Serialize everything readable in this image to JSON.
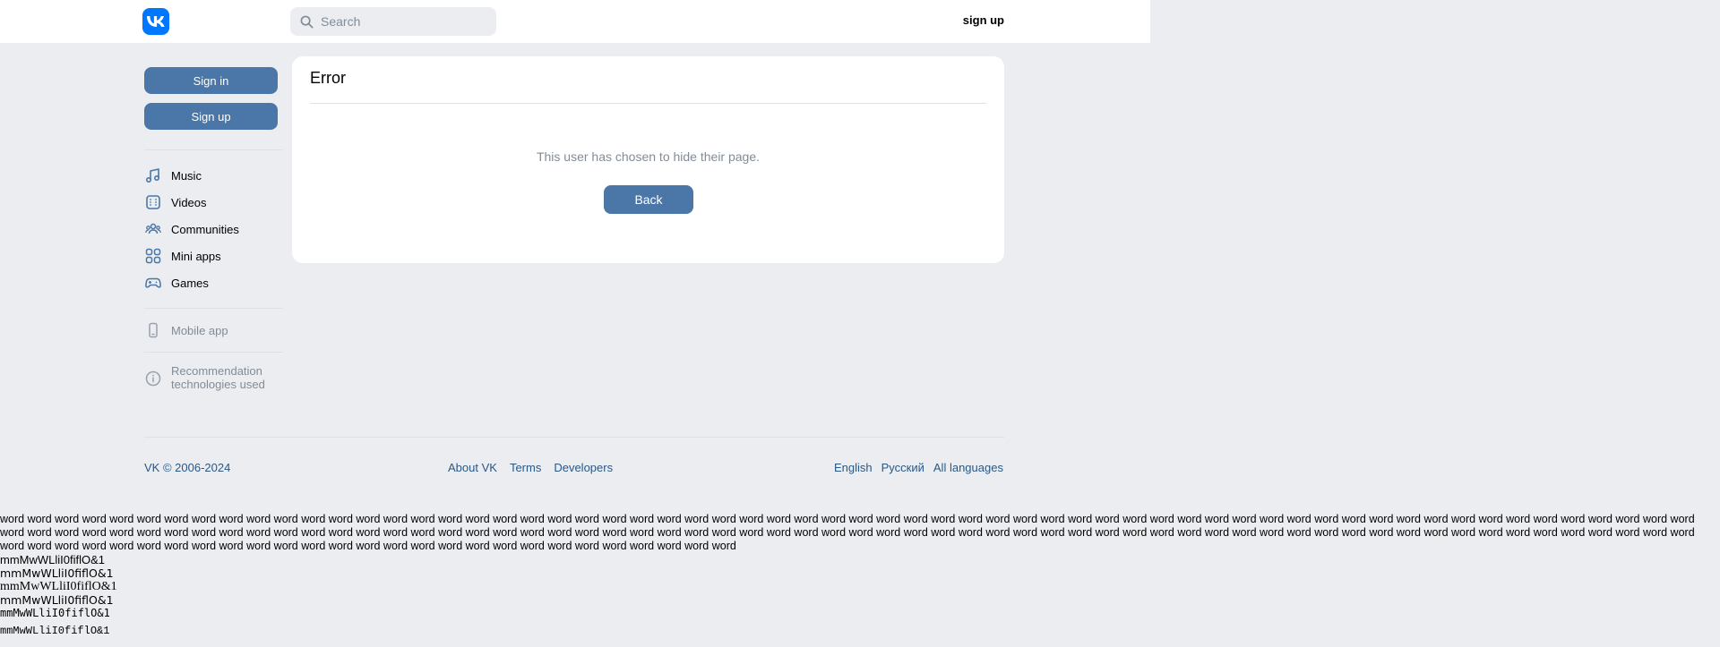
{
  "header": {
    "search_placeholder": "Search",
    "signup_label": "sign up"
  },
  "sidebar": {
    "signin_label": "Sign in",
    "signup_label": "Sign up",
    "items": [
      {
        "label": "Music",
        "icon": "music-icon"
      },
      {
        "label": "Videos",
        "icon": "video-icon"
      },
      {
        "label": "Communities",
        "icon": "communities-icon"
      },
      {
        "label": "Mini apps",
        "icon": "mini-apps-icon"
      },
      {
        "label": "Games",
        "icon": "gamepad-icon"
      }
    ],
    "mobile_app_label": "Mobile app",
    "recommendation_label": "Recommendation technologies used"
  },
  "card": {
    "title": "Error",
    "message": "This user has chosen to hide their page.",
    "back_label": "Back"
  },
  "footer": {
    "copyright": "VK © 2006-2024",
    "links": [
      "About VK",
      "Terms",
      "Developers"
    ],
    "languages": [
      "English",
      "Русский",
      "All languages"
    ]
  },
  "test_text": {
    "words_line": "word word word word word word word word word word word word word word word word word word word word word word word word word word word word word word word word word word word word word word word word word word word word word word word word word word word word word word word word word word word word word word word word word word word word word word word word word word word word word word word word word word word word word word word word word word word word word word word word word word word word word word word word word word word word word word word word word word word word word word word word word word word word word word word word word word word word word word word word word word word word word word word word word word word word word word word",
    "glyph_lines": [
      "mmMwWLliI0fiflO&1",
      "mmMwWLliI0fiflO&1",
      "mmMwWLliI0fiflO&1",
      "mmMwWLliI0fiflO&1",
      "mmMwWLliI0fiflO&1",
      "mmMwWLliI0fiflO&1"
    ]
  },
  "colors": {
    "background": "#ebedf0",
    "accent": "#4a76a8",
    "link": "#2a5885",
    "muted": "#818c99",
    "logo": "#0077ff"
  }
}
